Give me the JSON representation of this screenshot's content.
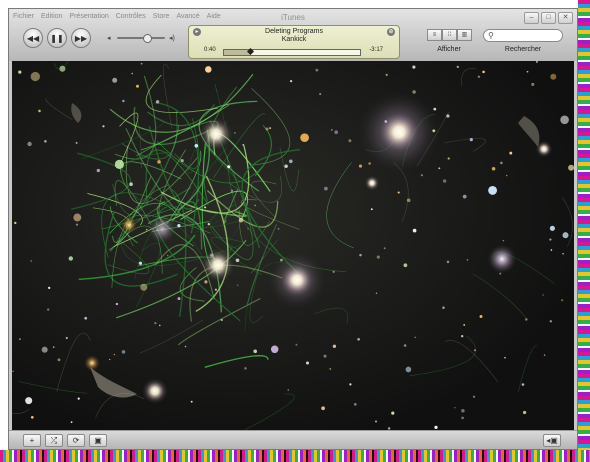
{
  "window": {
    "title": "iTunes"
  },
  "menu": {
    "items": [
      "Fichier",
      "Edition",
      "Présentation",
      "Contrôles",
      "Store",
      "Avancé",
      "Aide"
    ]
  },
  "player": {
    "song_title": "Deleting Programs",
    "artist": "Kankick",
    "elapsed": "0:40",
    "remaining": "-3:17",
    "progress_fraction": 0.2,
    "volume_fraction": 0.62
  },
  "toolbar": {
    "view_label": "Afficher",
    "search_label": "Rechercher",
    "search_placeholder": ""
  },
  "icons": {
    "previous": "previous-track-icon",
    "play_pause": "pause-icon",
    "next": "next-track-icon",
    "add": "add-playlist-icon",
    "shuffle": "shuffle-icon",
    "repeat": "repeat-icon",
    "artwork": "show-artwork-icon",
    "visualizer": "visualizer-toggle-icon"
  },
  "colors": {
    "lcd": "#e6e8c4",
    "visualizer_bg": "#151515",
    "chrome": "#c9c9c9"
  }
}
